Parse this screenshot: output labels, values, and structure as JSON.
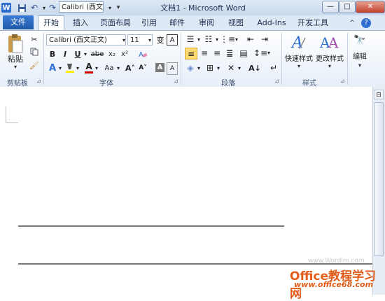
{
  "titlebar": {
    "app_icon": "W",
    "save_icon": "save-icon",
    "undo_glyph": "↶",
    "redo_glyph": "↷",
    "font_picker": "Calibri (西文j",
    "title": "文档1 - Microsoft Word",
    "minimize": "—",
    "maximize": "□",
    "close": "✕"
  },
  "tabs": [
    "文件",
    "开始",
    "插入",
    "页面布局",
    "引用",
    "邮件",
    "审阅",
    "视图",
    "Add-Ins",
    "开发工具"
  ],
  "ribbon_right": {
    "help": "?",
    "caret": "^"
  },
  "clipboard": {
    "paste": "粘贴",
    "group": "剪贴板"
  },
  "font": {
    "family": "Calibri (西文正文)",
    "size": "11",
    "bold": "B",
    "italic": "I",
    "underline": "U",
    "strike": "abe",
    "subscript": "x₂",
    "superscript": "x²",
    "grow": "A˄",
    "shrink": "A˅",
    "case": "Aa",
    "color_letter": "A",
    "clear": "A",
    "phonetic": "变",
    "border_char": "A",
    "group": "字体"
  },
  "paragraph": {
    "group": "段落"
  },
  "styles": {
    "quick": "快速样式",
    "change": "更改样式",
    "group": "样式"
  },
  "editing": {
    "label": "编辑"
  },
  "watermark": {
    "main": "Office教程学习网",
    "url": "www.office68.com",
    "faint": "www.Wordlm.com"
  },
  "colors": {
    "file_tab": "#2a6cc4",
    "highlight": "#fbd970",
    "font_red": "#d00000",
    "accent_blue": "#2e6fd1",
    "watermark": "#e35d1a"
  }
}
